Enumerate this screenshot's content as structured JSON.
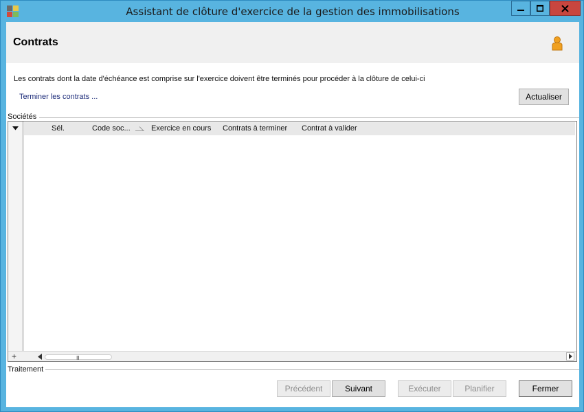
{
  "window": {
    "title": "Assistant de clôture d'exercice de la gestion des immobilisations",
    "icons": {
      "app": "app-icon",
      "minimize": "minimize-icon",
      "maximize": "maximize-icon",
      "close": "close-icon"
    }
  },
  "header": {
    "title": "Contrats",
    "user_icon": "user-icon"
  },
  "main": {
    "info_text": "Les contrats dont la date d'échéance est comprise sur l'exercice doivent être terminés pour procéder à la clôture de celui-ci",
    "link_label": "Terminer les contrats ...",
    "refresh_label": "Actualiser"
  },
  "societes": {
    "group_label": "Sociétés",
    "columns": [
      "Sél.",
      "Code soc...",
      "Exercice en cours",
      "Contrats à terminer",
      "Contrat à valider"
    ],
    "rows": [],
    "footer_plus": "+",
    "scrollbar_grip": "III"
  },
  "traitement": {
    "group_label": "Traitement",
    "buttons": {
      "previous": "Précédent",
      "next": "Suivant",
      "execute": "Exécuter",
      "plan": "Planifier",
      "close": "Fermer"
    }
  },
  "colors": {
    "title_bar": "#58b4e0",
    "close_button": "#c8463f",
    "link": "#1d2c7a",
    "user_icon": "#f0a020"
  }
}
